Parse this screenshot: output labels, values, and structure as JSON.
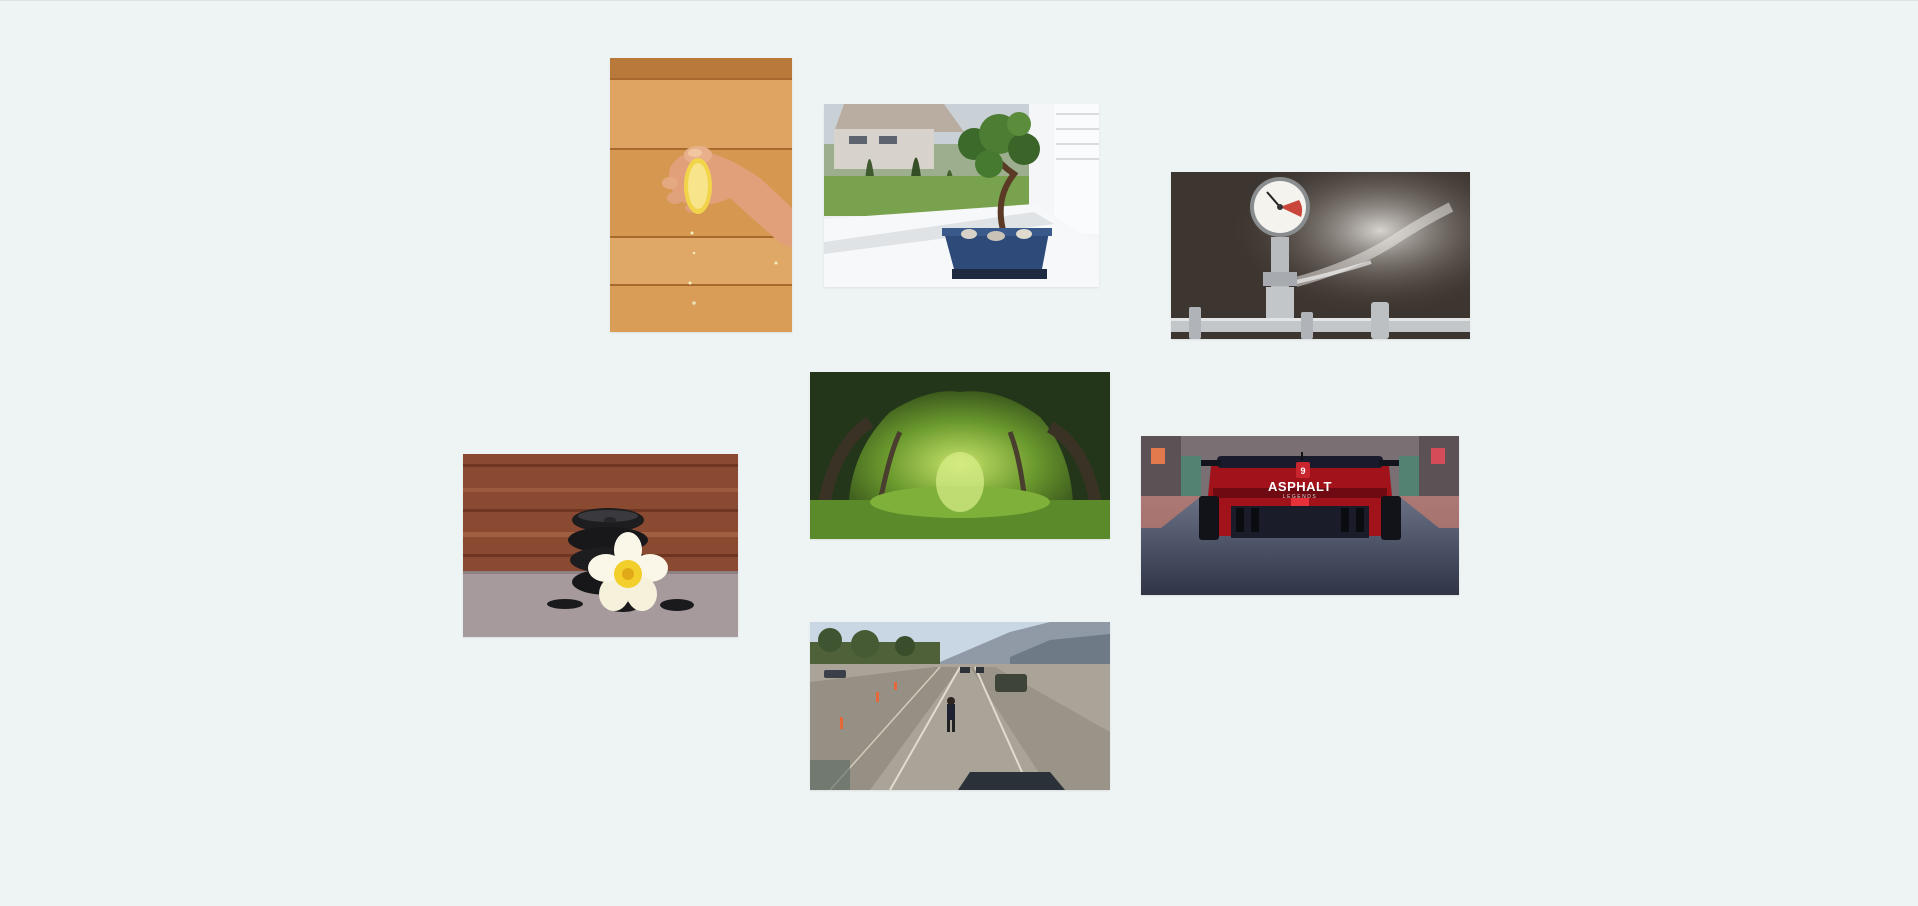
{
  "gallery": {
    "background": "#eef3f4",
    "images": [
      {
        "name": "hand-squeezing-lemon-photo",
        "subject": "hand squeezing lemon over wooden planks"
      },
      {
        "name": "bonsai-on-windowsill-photo",
        "subject": "bonsai tree in blue pot on windowsill"
      },
      {
        "name": "pressure-gauge-steam-photo",
        "subject": "pressure gauge on steel pipe with steam"
      },
      {
        "name": "forest-tunnel-photo",
        "subject": "green forest tree tunnel"
      },
      {
        "name": "spa-stones-flower-photo",
        "subject": "black spa stones with white frangipani flower"
      },
      {
        "name": "asphalt-racecar-photo",
        "subject": "red race car rear view on cobblestone street"
      },
      {
        "name": "highway-game-scene-photo",
        "subject": "person walking on highway in game scene"
      }
    ]
  },
  "asphalt": {
    "badge": "9",
    "title": "ASPHALT",
    "subtitle": "LEGENDS"
  }
}
